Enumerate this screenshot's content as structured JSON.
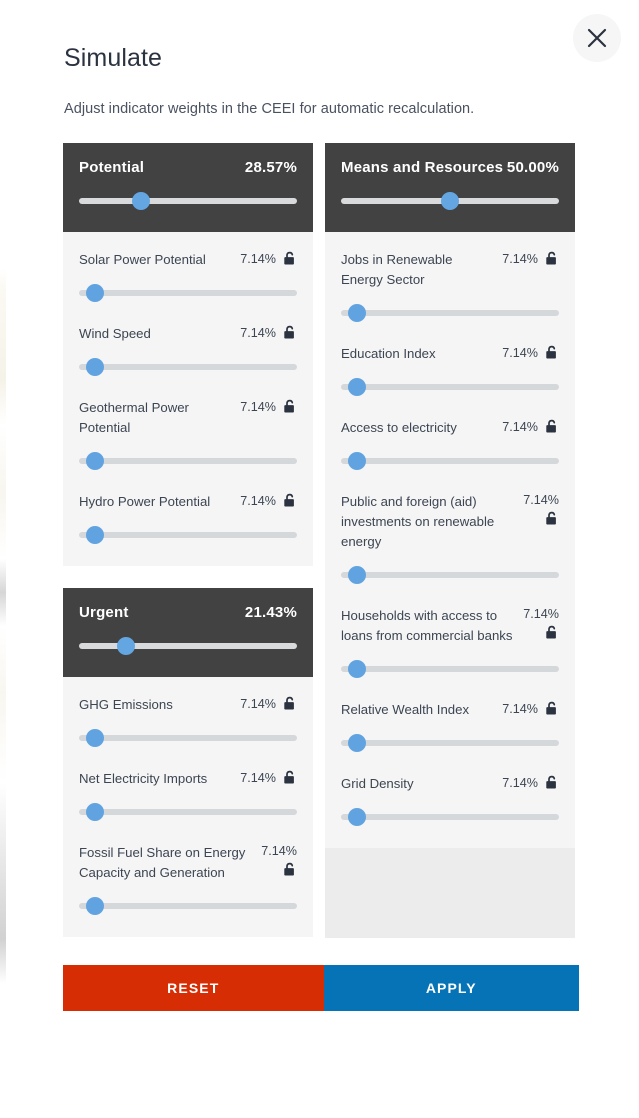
{
  "dialog": {
    "title": "Simulate",
    "subtitle": "Adjust indicator weights in the CEEI for automatic recalculation.",
    "close_icon": "close-icon"
  },
  "colors": {
    "group_header_bg": "#424242",
    "group_body_bg": "#f5f5f5",
    "slider_thumb": "#61a3e0",
    "slider_track": "#d5d8da",
    "reset_button": "#d62d04",
    "apply_button": "#0673b6",
    "filler_bg": "#ececec"
  },
  "columns": [
    {
      "groups": [
        {
          "name": "Potential",
          "percent": "28.57%",
          "slider_value": 28.57,
          "indicators": [
            {
              "label": "Solar Power Potential",
              "percent": "7.14%",
              "slider_value": 7.14,
              "lock_icon": "unlocked-padlock-icon",
              "stacked": false
            },
            {
              "label": "Wind Speed",
              "percent": "7.14%",
              "slider_value": 7.14,
              "lock_icon": "unlocked-padlock-icon",
              "stacked": false
            },
            {
              "label": "Geothermal Power Potential",
              "percent": "7.14%",
              "slider_value": 7.14,
              "lock_icon": "unlocked-padlock-icon",
              "stacked": false
            },
            {
              "label": "Hydro Power Potential",
              "percent": "7.14%",
              "slider_value": 7.14,
              "lock_icon": "unlocked-padlock-icon",
              "stacked": false
            }
          ]
        },
        {
          "name": "Urgent",
          "percent": "21.43%",
          "slider_value": 21.43,
          "indicators": [
            {
              "label": "GHG Emissions",
              "percent": "7.14%",
              "slider_value": 7.14,
              "lock_icon": "unlocked-padlock-icon",
              "stacked": false
            },
            {
              "label": "Net Electricity Imports",
              "percent": "7.14%",
              "slider_value": 7.14,
              "lock_icon": "unlocked-padlock-icon",
              "stacked": false
            },
            {
              "label": "Fossil Fuel Share on Energy Capacity and Generation",
              "percent": "7.14%",
              "slider_value": 7.14,
              "lock_icon": "unlocked-padlock-icon",
              "stacked": true
            }
          ]
        }
      ]
    },
    {
      "groups": [
        {
          "name": "Means and Resources",
          "percent": "50.00%",
          "slider_value": 50.0,
          "indicators": [
            {
              "label": "Jobs in Renewable Energy Sector",
              "percent": "7.14%",
              "slider_value": 7.14,
              "lock_icon": "unlocked-padlock-icon",
              "stacked": false
            },
            {
              "label": "Education Index",
              "percent": "7.14%",
              "slider_value": 7.14,
              "lock_icon": "unlocked-padlock-icon",
              "stacked": false
            },
            {
              "label": "Access to electricity",
              "percent": "7.14%",
              "slider_value": 7.14,
              "lock_icon": "unlocked-padlock-icon",
              "stacked": false
            },
            {
              "label": "Public and foreign (aid) investments on renewable energy",
              "percent": "7.14%",
              "slider_value": 7.14,
              "lock_icon": "unlocked-padlock-icon",
              "stacked": true
            },
            {
              "label": "Households with access to loans from commercial banks",
              "percent": "7.14%",
              "slider_value": 7.14,
              "lock_icon": "unlocked-padlock-icon",
              "stacked": true
            },
            {
              "label": "Relative Wealth Index",
              "percent": "7.14%",
              "slider_value": 7.14,
              "lock_icon": "unlocked-padlock-icon",
              "stacked": false
            },
            {
              "label": "Grid Density",
              "percent": "7.14%",
              "slider_value": 7.14,
              "lock_icon": "unlocked-padlock-icon",
              "stacked": false
            }
          ],
          "has_filler": true
        }
      ]
    }
  ],
  "actions": {
    "reset_label": "RESET",
    "apply_label": "APPLY"
  }
}
